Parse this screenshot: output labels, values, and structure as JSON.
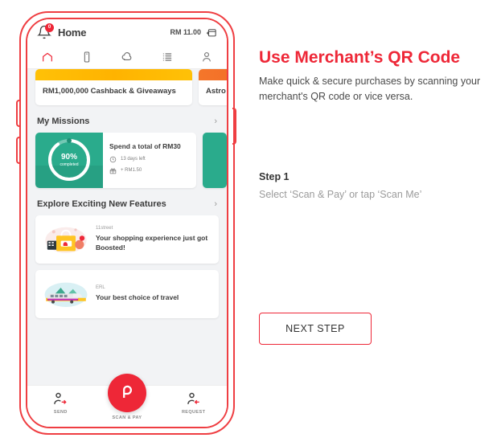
{
  "phone": {
    "header": {
      "notification_icon": "bell-icon",
      "notification_count": "0",
      "title": "Home",
      "balance": "RM 11.00",
      "wallet_icon": "add-wallet-icon"
    },
    "nav_items": [
      {
        "icon": "home-icon",
        "active": true
      },
      {
        "icon": "mobile-icon",
        "active": false
      },
      {
        "icon": "boost-cloud-icon",
        "active": false
      },
      {
        "icon": "list-icon",
        "active": false
      },
      {
        "icon": "person-icon",
        "active": false
      }
    ],
    "banners": [
      {
        "title": "RM1,000,000 Cashback & Giveaways",
        "image": "yellow-promo-image"
      },
      {
        "title": "Astro\nipsu",
        "image": "orange-promo-image"
      }
    ],
    "missions": {
      "section_title": "My Missions",
      "chevron_icon": "chevron-right-icon",
      "cards": [
        {
          "percent": "90%",
          "percent_sub": "completed",
          "progress": 90,
          "title": "Spend a total of RM30",
          "time_icon": "clock-icon",
          "time_left": "13 days left",
          "reward_icon": "gift-icon",
          "reward": "+ RM1.50"
        }
      ]
    },
    "features": {
      "section_title": "Explore Exciting New Features",
      "chevron_icon": "chevron-right-icon",
      "items": [
        {
          "brand": "11street",
          "description": "Your shopping experience just got Boosted!",
          "image": "shopping-bag-illustration"
        },
        {
          "brand": "ERL",
          "description": "Your best choice of travel",
          "image": "train-illustration"
        }
      ]
    },
    "bottom_nav": [
      {
        "label": "SEND",
        "icon": "send-person-icon"
      },
      {
        "label": "SCAN & PAY",
        "icon": "boost-logo-icon"
      },
      {
        "label": "REQUEST",
        "icon": "request-person-icon"
      }
    ]
  },
  "panel": {
    "title": "Use Merchant’s QR Code",
    "description": "Make quick & secure purchases by scanning your merchant's QR code or vice versa.",
    "step_label": "Step 1",
    "step_text": "Select ‘Scan & Pay’ or tap ‘Scan Me’",
    "next_button": "NEXT STEP"
  },
  "colors": {
    "brand_red": "#ee2737",
    "frame_red": "#ef3e42",
    "mission_teal": "#2aab8c",
    "muted_gray": "#9b9b9b"
  }
}
